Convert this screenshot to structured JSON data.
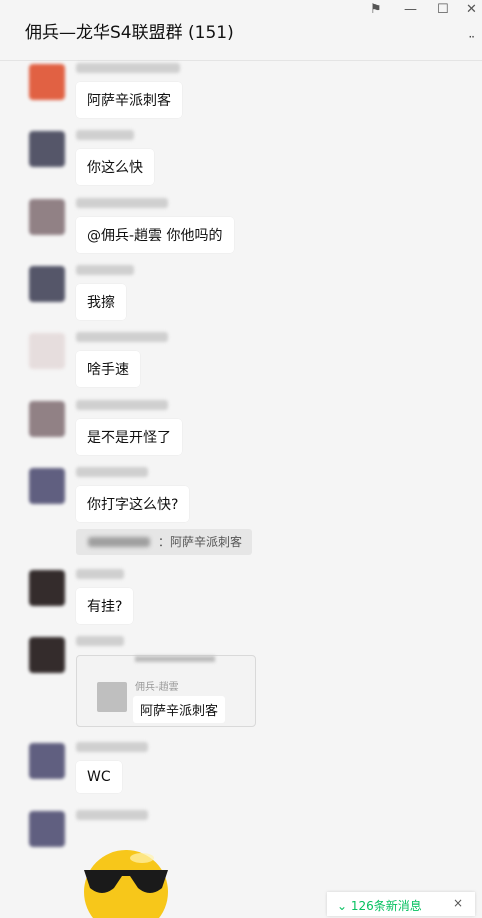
{
  "window": {
    "title": "佣兵—龙华S4联盟群 (151)",
    "pin_icon": "pin-icon",
    "min_icon": "minimize-icon",
    "max_icon": "maximize-icon",
    "close_icon": "close-icon",
    "more_icon": "more-icon"
  },
  "messages": [
    {
      "text": "阿萨辛派刺客",
      "avatar_color": "#e05a3a"
    },
    {
      "text": "你这么快",
      "avatar_color": "#4d4e62"
    },
    {
      "text": "@佣兵-趙雲 你他吗的",
      "avatar_color": "#8c7b80"
    },
    {
      "text": "我擦",
      "avatar_color": "#4d4e62"
    },
    {
      "text": "啥手速",
      "avatar_color": "#e6dcdc"
    },
    {
      "text": " 是不是开怪了",
      "avatar_color": "#8c7b80"
    },
    {
      "text": "你打字这么快?",
      "avatar_color": "#59587a",
      "quote": "：阿萨辛派刺客"
    },
    {
      "text": "有挂?",
      "avatar_color": "#2a2222"
    },
    {
      "card_name": "佣兵-趙雲",
      "card_text": "阿萨辛派刺客",
      "avatar_color": "#2a2222"
    },
    {
      "text": "WC",
      "avatar_color": "#59587a"
    },
    {
      "avatar_color": "#59587a",
      "emoji": "cool-sunglasses-emoji"
    }
  ],
  "new_messages": {
    "label": "126条新消息",
    "close": "×",
    "down_icon": "chevron-down-icon"
  }
}
